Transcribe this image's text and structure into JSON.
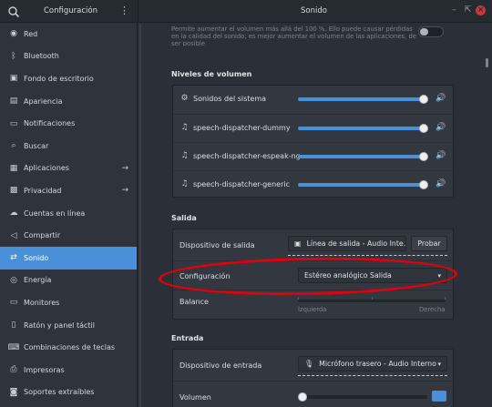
{
  "window": {
    "app_title": "Configuración",
    "panel_title": "Sonido",
    "menu_glyph": "⋮",
    "controls": {
      "minimize": "–",
      "maximize": "⇱",
      "close": "×"
    }
  },
  "sidebar": {
    "items": [
      {
        "label": "Red",
        "icon": "network-icon",
        "glyph": "◉"
      },
      {
        "label": "Bluetooth",
        "icon": "bluetooth-icon",
        "glyph": "ᛒ"
      },
      {
        "label": "Fondo de escritorio",
        "icon": "wallpaper-icon",
        "glyph": "▣"
      },
      {
        "label": "Apariencia",
        "icon": "appearance-icon",
        "glyph": "▤"
      },
      {
        "label": "Notificaciones",
        "icon": "notification-icon",
        "glyph": "▭"
      },
      {
        "label": "Buscar",
        "icon": "search-icon",
        "glyph": "⌕"
      },
      {
        "label": "Aplicaciones",
        "icon": "apps-icon",
        "glyph": "▦",
        "arrow": "→"
      },
      {
        "label": "Privacidad",
        "icon": "privacy-icon",
        "glyph": "▩",
        "arrow": "→"
      },
      {
        "label": "Cuentas en línea",
        "icon": "cloud-icon",
        "glyph": "☁"
      },
      {
        "label": "Compartir",
        "icon": "share-icon",
        "glyph": "◁"
      },
      {
        "label": "Sonido",
        "icon": "sound-icon",
        "glyph": "⇄",
        "active": true
      },
      {
        "label": "Energía",
        "icon": "power-icon",
        "glyph": "◎"
      },
      {
        "label": "Monitores",
        "icon": "display-icon",
        "glyph": "▭"
      },
      {
        "label": "Ratón y panel táctil",
        "icon": "mouse-icon",
        "glyph": "▯"
      },
      {
        "label": "Combinaciones de teclas",
        "icon": "keyboard-icon",
        "glyph": "⌨"
      },
      {
        "label": "Impresoras",
        "icon": "printer-icon",
        "glyph": "⎙"
      },
      {
        "label": "Soportes extraíbles",
        "icon": "media-icon",
        "glyph": "◙"
      }
    ]
  },
  "main": {
    "top_note": "Permite aumentar el volumen más allá del 100 %. Ello puede causar pérdidas en la calidad del sonido; es mejor aumentar el volumen de las aplicaciones, de ser posible",
    "over_amplification_on": false,
    "volume_levels": {
      "heading": "Niveles de volumen",
      "rows": [
        {
          "label": "Sonidos del sistema",
          "icon": "gear-icon",
          "glyph": "⚙",
          "level": 0.97
        },
        {
          "label": "speech-dispatcher-dummy",
          "icon": "audio-app-icon",
          "glyph": "♫",
          "level": 0.97
        },
        {
          "label": "speech-dispatcher-espeak-ng",
          "icon": "audio-app-icon",
          "glyph": "♫",
          "level": 0.97
        },
        {
          "label": "speech-dispatcher-generic",
          "icon": "audio-app-icon",
          "glyph": "♫",
          "level": 0.97
        }
      ],
      "speaker_glyph": "🔊"
    },
    "output": {
      "heading": "Salida",
      "device_label": "Dispositivo de salida",
      "device_value": "Línea de salida - Audio Inte…",
      "device_glyph": "▣",
      "test_button": "Probar",
      "config_label": "Configuración",
      "config_value": "Estéreo analógico Salida",
      "balance_label": "Balance",
      "balance_left": "Izquierda",
      "balance_right": "Derecha"
    },
    "input": {
      "heading": "Entrada",
      "device_label": "Dispositivo de entrada",
      "device_value": "Micrófono trasero - Audio Interno",
      "device_glyph": "🎙",
      "volume_label": "Volumen",
      "volume_level": 0.0
    },
    "caret": "▾"
  },
  "colors": {
    "accent": "#4a90d9",
    "annotation": "#e3000d",
    "close": "#cf3636"
  }
}
